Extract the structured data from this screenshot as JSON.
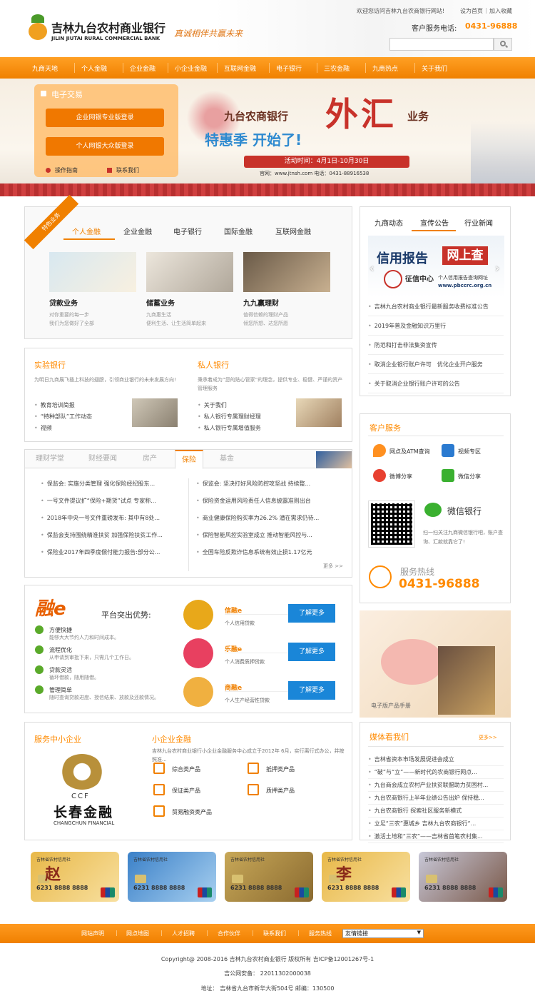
{
  "top": {
    "welcome": "欢迎您访问吉林九台农商银行网站!",
    "set_home": "设为首页",
    "favorite": "加入收藏",
    "service_label": "客户服务电话:",
    "service_phone": "0431-96888",
    "logo_cn": "吉林九台农村商业银行",
    "logo_en": "JILIN JIUTAI RURAL COMMERCIAL BANK",
    "slogan": "真诚相伴共赢未来"
  },
  "nav": [
    "九商天地",
    "个人金融",
    "企业金融",
    "小企业金融",
    "互联网金融",
    "电子银行",
    "三农金融",
    "九商热点",
    "关于我们"
  ],
  "banner": {
    "ebank_title": "电子交易",
    "btn_corp": "企业网银专业版登录",
    "btn_personal": "个人网银大众版登录",
    "guide": "操作指南",
    "contact": "联系我们",
    "line1": "九台农商银行",
    "big": "外汇",
    "line1b": "业务",
    "line2": "特惠季 开始了!",
    "period": "活动时间：4月1日-10月30日",
    "site": "官网：www.jtnsh.com  电话：0431-88916538"
  },
  "featured": {
    "ribbon": "特色业务",
    "tabs": [
      "个人金融",
      "企业金融",
      "电子银行",
      "国际金融",
      "互联网金融"
    ],
    "items": [
      {
        "title": "贷款业务",
        "d1": "对你重要的每一步",
        "d2": "我们为您做好了全部"
      },
      {
        "title": "储蓄业务",
        "d1": "九商惠生活",
        "d2": "便利生活、让生活简单起来"
      },
      {
        "title": "九九赢理财",
        "d1": "值得信赖的理财产品",
        "d2": "倾您所想、达您所愿"
      }
    ]
  },
  "news": {
    "tabs": [
      "九商动态",
      "宣传公告",
      "行业新闻"
    ],
    "banner_t1": "信用报告",
    "banner_t2": "网上查",
    "banner_c1": "征信中心",
    "banner_c2": "个人信用报告查询网址",
    "banner_c3": "www.pbccrc.org.cn",
    "items": [
      "吉林九台农村商业银行最新服务收费标准公告",
      "2019年普及金融知识万里行",
      "防范和打击非法集资宣传",
      "取消企业银行账户许可　优化企业开户服务",
      "关于取消企业银行账户许可的公告"
    ]
  },
  "lab": {
    "title": "实验银行",
    "desc": "为明日九商展飞插上科技的翅膀，引领商业银行的未来发展方向!",
    "items": [
      "教育培训简报",
      "“特种部队”工作动态",
      "视频"
    ]
  },
  "private": {
    "title": "私人银行",
    "desc": "秉承着成为“您的贴心管家”的理念，提供专业、稳健、严谨的资产管理服务",
    "items": [
      "关于我们",
      "私人银行专属理财经理",
      "私人银行专属增值服务"
    ]
  },
  "finance": {
    "tabs": [
      "理财学堂",
      "财经要闻",
      "房产",
      "保险",
      "基金"
    ],
    "left": [
      "保监会: 实施分类管理 强化保险经纪股东...",
      "一号文件提议扩“保险+期货”试点 专家称...",
      "2018年中央一号文件重磅发布: 其中有8处...",
      "保监会支持围绕精准扶贫 加强保险扶贫工作...",
      "保险业2017年四季度偿付能力报告:部分公..."
    ],
    "right": [
      "保监会: 坚决打好风险防控攻坚战 持续整...",
      "保险资金运用风险责任人信息披露准则出台",
      "商业健康保险购买率为26.2% 潜在需求仍待...",
      "保险智能风控实验室成立 推动智能风控与...",
      "全国车险反欺诈信息系统有效止损1.17亿元"
    ],
    "more": "更多 >>"
  },
  "customer": {
    "title": "客户服务",
    "links": [
      "网点及ATM查询",
      "视频专区",
      "微博分享",
      "微信分享"
    ],
    "wechat_title": "微信银行",
    "wechat_desc": "扫一扫关注九商微信银行吧，账户查询、汇款就靠它了!",
    "hotline_label": "服务热线",
    "hotline": "0431-96888"
  },
  "ronge": {
    "logo": "融e",
    "headline": "平台突出优势:",
    "features": [
      {
        "t": "方便快捷",
        "d": "能够大大节约人力和时间成本。"
      },
      {
        "t": "流程优化",
        "d": "从申请到审批下来，只需几个工作日。"
      },
      {
        "t": "贷款灵活",
        "d": "循环借款，随用随借。"
      },
      {
        "t": "管理简单",
        "d": "随时查询贷款进度、授信结果、放款及还款情况。"
      }
    ],
    "products": [
      {
        "name": "信融e",
        "desc": "个人信用贷款"
      },
      {
        "name": "乐融e",
        "desc": "个人消费质押贷款"
      },
      {
        "name": "商融e",
        "desc": "个人生产经营性贷款"
      }
    ],
    "btn": "了解更多"
  },
  "brochure": "电子版产品手册",
  "sme": {
    "title_left": "服务中小企业",
    "ccf_logo": "CCF",
    "ccf_cn": "长春金融",
    "ccf_en": "CHANGCHUN FINANCIAL",
    "title": "小企业金融",
    "desc": "吉林九台农村商业银行小企业金融服务中心成立于2012年 6月，实行离行式办公，并按照准...",
    "products": [
      "综合类产品",
      "抵押类产品",
      "保证类产品",
      "质押类产品",
      "贸易融资类产品"
    ]
  },
  "media": {
    "title": "媒体看我们",
    "more": "更多>>",
    "items": [
      "吉林省资本市场发展促进会成立",
      "“破”与“立”——新时代的农商银行网点...",
      "九台商会成立农村产业扶贫联盟助力贫困村...",
      "九台农商银行上半年业绩公告出炉 保持稳...",
      "九台农商银行 探索社区服务新模式",
      "立足“三农”惠城乡 吉林九台农商银行“...",
      "激活土地和“三农”——吉林省首笔农村集..."
    ]
  },
  "cards": [
    {
      "bank": "吉林省农村信用社",
      "num": "6231 8888 8888",
      "name": "赵"
    },
    {
      "bank": "吉林省农村信用社",
      "num": "6231 8888 8888",
      "name": ""
    },
    {
      "bank": "吉林省农村信用社",
      "num": "6231 8888 8888",
      "name": ""
    },
    {
      "bank": "吉林省农村信用社",
      "num": "6231 8888 8888",
      "name": "李"
    },
    {
      "bank": "吉林省农村信用社",
      "num": "6231 8888 8888",
      "name": ""
    }
  ],
  "footer": {
    "links": [
      "网站声明",
      "网点地图",
      "人才招聘",
      "合作伙伴",
      "联系我们",
      "服务热线"
    ],
    "select": "友情链接",
    "copy": "Copyright@ 2008-2016 吉林九台农村商业银行 版权所有 吉ICP备12001267号-1",
    "police": "吉公网安备： 22011302000038",
    "addr": "地址： 吉林省九台市新华大街504号 邮编：130500"
  },
  "colors": {
    "accent": "#ff8a00",
    "blue": "#1a86d8",
    "red": "#c8322a"
  }
}
